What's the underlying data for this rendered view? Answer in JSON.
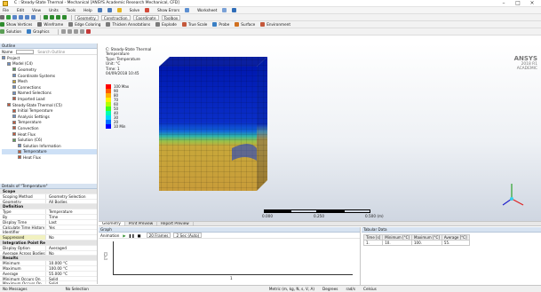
{
  "window": {
    "title": "C : Steady-State Thermal - Mechanical [ANSYS Academic Research Mechanical, CFD]",
    "minimize": "–",
    "maximize": "□",
    "close": "×"
  },
  "menu": [
    "File",
    "Edit",
    "View",
    "Units",
    "Tools",
    "Help"
  ],
  "toolbar1": {
    "solve": "Solve",
    "show_errors": "Show Errors",
    "worksheet": "Worksheet"
  },
  "toolbar2": {
    "show_vertices": "Show Vertices",
    "wireframe": "Wireframe",
    "edge_coloring": "Edge Coloring",
    "thicken": "Thicken Annotations",
    "explode": "Explode"
  },
  "toolbar3": {
    "scale": "True Scale",
    "probe": "Probe",
    "surface": "Surface",
    "edge_coloring": "Edge Coloring",
    "environment": "Environment",
    "solution": "Solution",
    "graphics": "Graphics"
  },
  "toolbar_right": {
    "geometry": "Geometry",
    "construction": "Construction",
    "coordinate": "Coordinate",
    "toolbox": "Toolbox"
  },
  "outline": {
    "title": "Outline",
    "filter_label": "Name",
    "search_placeholder": "Search Outline",
    "nodes": [
      {
        "label": "Project",
        "indent": 0,
        "color": "#6b8fc8"
      },
      {
        "label": "Model (C4)",
        "indent": 1,
        "color": "#6b8fc8"
      },
      {
        "label": "Geometry",
        "indent": 2,
        "color": "#5a9e55"
      },
      {
        "label": "Coordinate Systems",
        "indent": 2,
        "color": "#6b8fc8"
      },
      {
        "label": "Mesh",
        "indent": 2,
        "color": "#c6a239"
      },
      {
        "label": "Connections",
        "indent": 2,
        "color": "#6b8fc8"
      },
      {
        "label": "Named Selections",
        "indent": 2,
        "color": "#6b8fc8"
      },
      {
        "label": "Imported Load",
        "indent": 2,
        "color": "#c4583b"
      },
      {
        "label": "Steady-State Thermal (C5)",
        "indent": 1,
        "color": "#c4583b"
      },
      {
        "label": "Initial Temperature",
        "indent": 2,
        "color": "#c4583b"
      },
      {
        "label": "Analysis Settings",
        "indent": 2,
        "color": "#6b8fc8"
      },
      {
        "label": "Temperature",
        "indent": 2,
        "color": "#c4583b"
      },
      {
        "label": "Convection",
        "indent": 2,
        "color": "#c4583b"
      },
      {
        "label": "Heat Flux",
        "indent": 2,
        "color": "#c4583b"
      },
      {
        "label": "Solution (C6)",
        "indent": 2,
        "color": "#5a9e55"
      },
      {
        "label": "Solution Information",
        "indent": 3,
        "color": "#6b8fc8"
      },
      {
        "label": "Temperature",
        "indent": 3,
        "color": "#c4583b"
      },
      {
        "label": "Heat Flux",
        "indent": 3,
        "color": "#c4583b"
      }
    ],
    "selected_index": 16
  },
  "details": {
    "title": "Details of \"Temperature\"",
    "rows": [
      {
        "k": "Scope",
        "v": "",
        "section": true
      },
      {
        "k": "Scoping Method",
        "v": "Geometry Selection"
      },
      {
        "k": "Geometry",
        "v": "All Bodies"
      },
      {
        "k": "Definition",
        "v": "",
        "section": true
      },
      {
        "k": "Type",
        "v": "Temperature"
      },
      {
        "k": "By",
        "v": "Time"
      },
      {
        "k": "Display Time",
        "v": "Last"
      },
      {
        "k": "Calculate Time History",
        "v": "Yes"
      },
      {
        "k": "Identifier",
        "v": ""
      },
      {
        "k": "Suppressed",
        "v": "No"
      },
      {
        "k": "Integration Point Results",
        "v": "",
        "section": true
      },
      {
        "k": "Display Option",
        "v": "Averaged"
      },
      {
        "k": "Average Across Bodies",
        "v": "No"
      },
      {
        "k": "Results",
        "v": "",
        "section": true
      },
      {
        "k": "Minimum",
        "v": "10.000 °C"
      },
      {
        "k": "Maximum",
        "v": "100.00 °C"
      },
      {
        "k": "Average",
        "v": "55.000 °C"
      },
      {
        "k": "Minimum Occurs On",
        "v": "Solid"
      },
      {
        "k": "Maximum Occurs On",
        "v": "Solid"
      }
    ]
  },
  "viewport": {
    "caption": [
      "C: Steady-State Thermal",
      "Temperature",
      "Type: Temperature",
      "Unit: °C",
      "Time: 1",
      "04/09/2018 10:45"
    ],
    "ansys_brand": "ANSYS",
    "ansys_version": "2018 R1",
    "ansys_edition": "ACADEMIC",
    "scale_labels": [
      "0.000",
      "0.250",
      "0.500 (m)"
    ],
    "legend": [
      {
        "label": "100 Max",
        "color": "#ff0000"
      },
      {
        "label": "90",
        "color": "#ff5a00"
      },
      {
        "label": "80",
        "color": "#ffb000"
      },
      {
        "label": "70",
        "color": "#fff000"
      },
      {
        "label": "60",
        "color": "#b2ff00"
      },
      {
        "label": "50",
        "color": "#40ff20"
      },
      {
        "label": "40",
        "color": "#00ffb0"
      },
      {
        "label": "30",
        "color": "#00d8ff"
      },
      {
        "label": "20",
        "color": "#0070ff"
      },
      {
        "label": "10 Min",
        "color": "#0000ff"
      }
    ]
  },
  "bottom_tabs": [
    "Geometry",
    "Print Preview",
    "Report Preview"
  ],
  "graph": {
    "title": "Graph",
    "animation_label": "Animation",
    "frames": "20 Frames",
    "time": "2 Sec (Auto)",
    "y_label": "[°C]",
    "x_tick": "1"
  },
  "tabular": {
    "title": "Tabular Data",
    "headers": [
      "Time [s]",
      "Minimum [°C]",
      "Maximum [°C]",
      "Average [°C]"
    ],
    "row": [
      "1.",
      "10.",
      "100.",
      "55."
    ]
  },
  "status": {
    "messages": "No Messages",
    "selection": "No Selection",
    "units": "Metric (m, kg, N, s, V, A)",
    "degrees": "Degrees",
    "rad": "rad/s",
    "celsius": "Celsius"
  }
}
